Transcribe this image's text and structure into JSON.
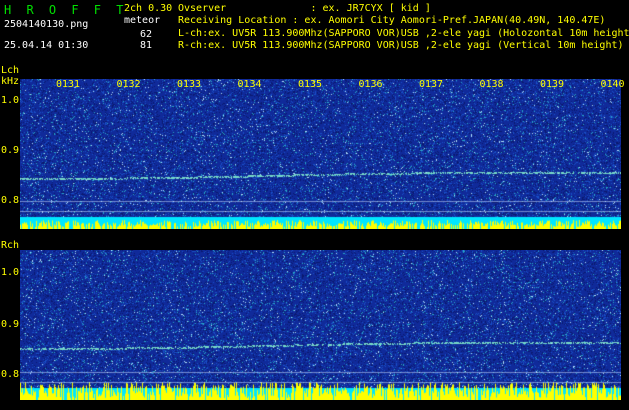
{
  "header": {
    "title": "H R O F F T",
    "filename": "2504140130.png",
    "datetime": "25.04.14 01:30",
    "channels": "2ch 0.30",
    "mode": "meteor",
    "count_l": "62",
    "count_r": "81",
    "observer": "Ovserver              : ex. JR7CYX [ kid ]",
    "location": "Receiving Location : ex. Aomori City Aomori-Pref.JAPAN(40.49N, 140.47E)",
    "lch_desc": "L-ch:ex. UV5R 113.900Mhz(SAPPORO VOR)USB ,2-ele yagi (Holozontal 10m height",
    "rch_desc": "R-ch:ex. UV5R 113.900Mhz(SAPPORO VOR)USB ,2-ele yagi (Vertical 10m height)"
  },
  "colors": {
    "background": "#000000",
    "label_yellow": "#ffff00",
    "title_green": "#00e000",
    "spectrogram_base": "#102a9a",
    "noise_cyan": "#00e6ff",
    "noise_yellow": "#ffff00"
  },
  "panels": [
    {
      "id": "lch",
      "name": "Lch",
      "unit": "kHz",
      "y_ticks": [
        "1.0",
        "0.9",
        "0.8"
      ],
      "time_ticks": [
        "0131",
        "0132",
        "0133",
        "0134",
        "0135",
        "0136",
        "0137",
        "0138",
        "0139",
        "0140"
      ],
      "carrier_khz": 0.845
    },
    {
      "id": "rch",
      "name": "Rch",
      "unit": "",
      "y_ticks": [
        "1.0",
        "0.9",
        "0.8"
      ],
      "time_ticks": [],
      "carrier_khz": 0.845
    }
  ]
}
